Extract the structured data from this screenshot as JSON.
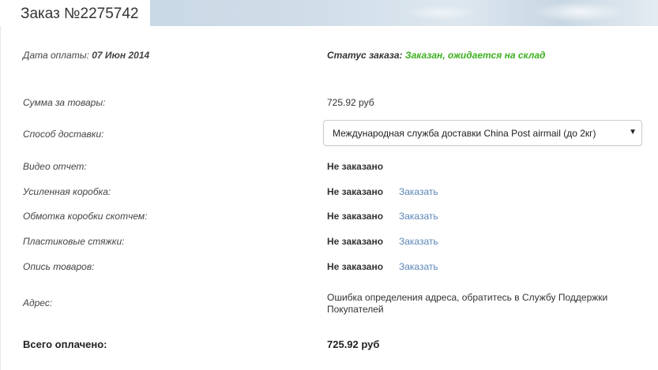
{
  "header": {
    "title": "Заказ №2275742"
  },
  "payment": {
    "label": "Дата оплаты:",
    "date": "07 Июн 2014"
  },
  "status": {
    "label": "Статус заказа:",
    "value": "Заказан, ожидается на склад",
    "color": "#3cb11e"
  },
  "goods_sum": {
    "label": "Сумма за товары:",
    "value": "725.92 руб"
  },
  "delivery": {
    "label": "Способ доставки:",
    "selected": "Международная служба доставки China Post airmail (до 2кг)"
  },
  "services": [
    {
      "label": "Видео отчет:",
      "status": "Не заказано",
      "action": ""
    },
    {
      "label": "Усиленная коробка:",
      "status": "Не заказано",
      "action": "Заказать"
    },
    {
      "label": "Обмотка коробки скотчем:",
      "status": "Не заказано",
      "action": "Заказать"
    },
    {
      "label": "Пластиковые стяжки:",
      "status": "Не заказано",
      "action": "Заказать"
    },
    {
      "label": "Опись товаров:",
      "status": "Не заказано",
      "action": "Заказать"
    }
  ],
  "address": {
    "label": "Адрес:",
    "value": "Ошибка определения адреса, обратитесь в Службу Поддержки Покупателей"
  },
  "total": {
    "label": "Всего оплачено:",
    "value": "725.92  руб"
  },
  "colors": {
    "link": "#5b86b8",
    "status_green": "#3cb11e"
  },
  "icons": {
    "dropdown": "chevron-down-icon"
  }
}
